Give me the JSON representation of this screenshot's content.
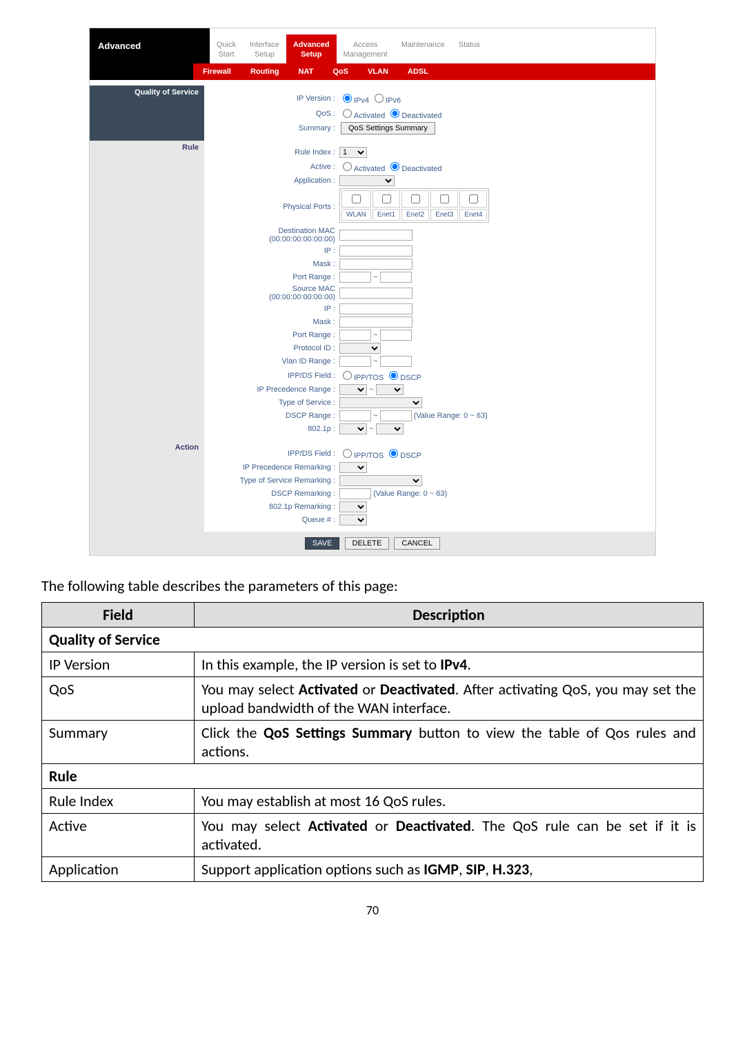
{
  "nav": {
    "side_label": "Advanced",
    "tabs": [
      {
        "l1": "Quick",
        "l2": "Start"
      },
      {
        "l1": "Interface",
        "l2": "Setup"
      },
      {
        "l1": "Advanced",
        "l2": "Setup"
      },
      {
        "l1": "Access",
        "l2": "Management"
      },
      {
        "l1": "Maintenance",
        "l2": ""
      },
      {
        "l1": "Status",
        "l2": ""
      }
    ],
    "subtabs": [
      "Firewall",
      "Routing",
      "NAT",
      "QoS",
      "VLAN"
    ],
    "adsl": "ADSL"
  },
  "sections": {
    "qos": "Quality of Service",
    "rule": "Rule",
    "action": "Action"
  },
  "qos": {
    "ipver_label": "IP Version :",
    "ipv4": "IPv4",
    "ipv6": "IPv6",
    "qos_label": "QoS :",
    "activated": "Activated",
    "deactivated": "Deactivated",
    "summary_label": "Summary :",
    "summary_btn": "QoS Settings Summary"
  },
  "rule": {
    "index": "Rule Index :",
    "index_val": "1",
    "active": "Active :",
    "activated": "Activated",
    "deactivated": "Deactivated",
    "application": "Application :",
    "pports": "Physical Ports :",
    "ports": [
      "WLAN",
      "Enet1",
      "Enet2",
      "Enet3",
      "Enet4"
    ],
    "dmac": "Destination MAC",
    "macfmt": "(00:00:00:00:00:00)",
    "ip": "IP :",
    "mask": "Mask :",
    "prange": "Port Range :",
    "smac": "Source MAC",
    "protoid": "Protocol ID :",
    "vlanid": "Vlan ID Range :",
    "ipds": "IPP/DS Field :",
    "ipptos": "IPP/TOS",
    "dscp": "DSCP",
    "ipprec": "IP Precedence Range :",
    "tos": "Type of Service :",
    "dscprange": "DSCP Range :",
    "valrange": "(Value Range: 0 ~ 63)",
    "p8021": "802.1p :"
  },
  "action": {
    "ipds": "IPP/DS Field :",
    "ipptos": "IPP/TOS",
    "dscp": "DSCP",
    "ipprec": "IP Precedence Remarking :",
    "tos": "Type of Service Remarking :",
    "dscprm": "DSCP Remarking :",
    "valrange": "(Value Range: 0 ~ 63)",
    "p8021": "802.1p Remarking :",
    "queue": "Queue # :"
  },
  "btns": {
    "save": "SAVE",
    "delete": "DELETE",
    "cancel": "CANCEL"
  },
  "intro": "The following table describes the parameters of this page:",
  "table": {
    "h1": "Field",
    "h2": "Description",
    "s1": "Quality of Service",
    "r1f": "IP Version",
    "r1d": "In this example, the IP version is set to IPv4.",
    "r2f": "QoS",
    "r2d": "You may select Activated or Deactivated. After activating QoS, you may set the upload bandwidth of the WAN interface.",
    "r3f": "Summary",
    "r3d": "Click the QoS Settings Summary button to view the table of Qos rules and actions.",
    "s2": "Rule",
    "r4f": "Rule Index",
    "r4d": "You may establish at most 16 QoS rules.",
    "r5f": "Active",
    "r5d": "You may select Activated or Deactivated. The QoS rule can be set if it is activated.",
    "r6f": "Application",
    "r6d": "Support application options such as IGMP, SIP, H.323,"
  },
  "page_number": "70"
}
